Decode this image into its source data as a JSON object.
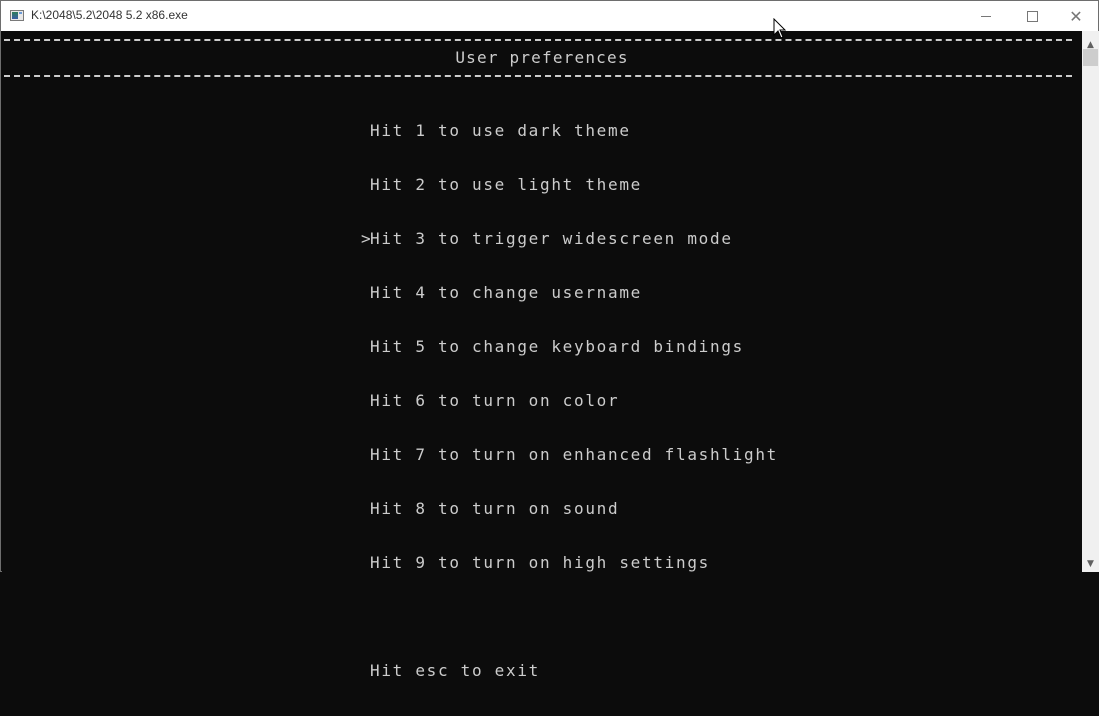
{
  "window": {
    "title": "K:\\2048\\5.2\\2048 5.2 x86.exe",
    "controls": {
      "minimize": "minimize",
      "maximize": "maximize",
      "close": "✕"
    }
  },
  "console": {
    "heading": "User preferences",
    "cursor": ">",
    "selected_index": 2,
    "menu_items": [
      "Hit 1 to use dark theme",
      "Hit 2 to use light theme",
      "Hit 3 to trigger widescreen mode",
      "Hit 4 to change username",
      "Hit 5 to change keyboard bindings",
      "Hit 6 to turn on color",
      "Hit 7 to turn on enhanced flashlight",
      "Hit 8 to turn on sound",
      "Hit 9 to turn on high settings"
    ],
    "exit_hint": "Hit esc to exit"
  },
  "scrollbar": {
    "up": "▲",
    "down": "▼"
  },
  "colors": {
    "console_bg": "#0c0c0c",
    "console_fg": "#cccccc"
  }
}
